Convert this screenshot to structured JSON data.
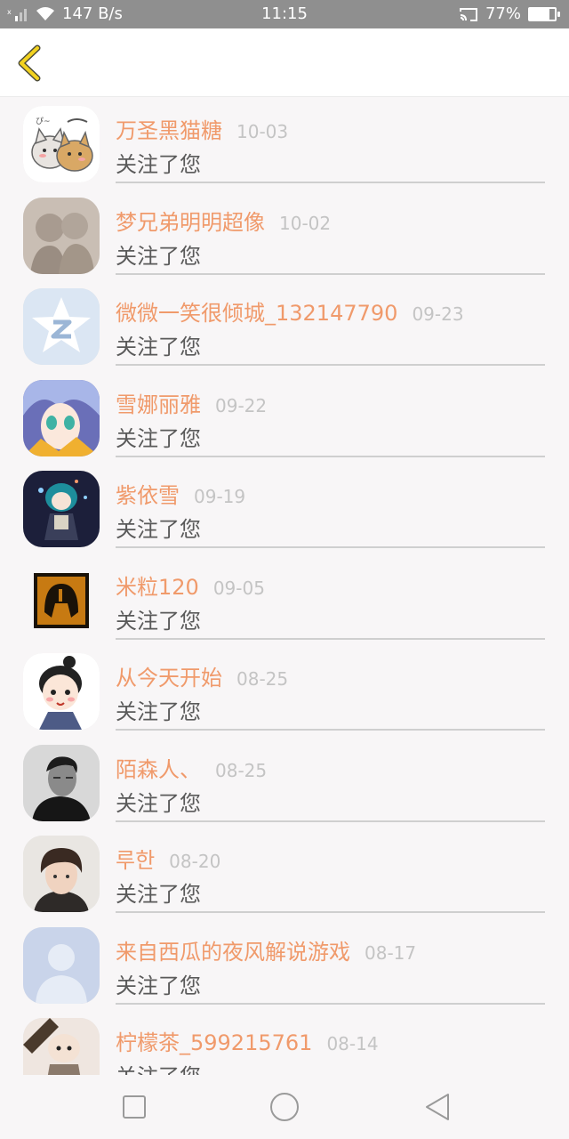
{
  "status_bar": {
    "network_speed": "147 B/s",
    "time": "11:15",
    "battery": "77%",
    "battery_level": 0.77
  },
  "header": {
    "back_icon": "chevron-left-icon"
  },
  "notifications": [
    {
      "name": "万圣黑猫糖",
      "date": "10-03",
      "action": "关注了您",
      "avatar": "cats-avatar"
    },
    {
      "name": "梦兄弟明明超像",
      "date": "10-02",
      "action": "关注了您",
      "avatar": "sketch-avatar"
    },
    {
      "name": "微微一笑很倾城_132147790",
      "date": "09-23",
      "action": "关注了您",
      "avatar": "qq-zone-avatar"
    },
    {
      "name": "雪娜丽雅",
      "date": "09-22",
      "action": "关注了您",
      "avatar": "anime-girl-avatar"
    },
    {
      "name": "紫依雪",
      "date": "09-19",
      "action": "关注了您",
      "avatar": "chibi-avatar"
    },
    {
      "name": "米粒120",
      "date": "09-05",
      "action": "关注了您",
      "avatar": "helmet-avatar"
    },
    {
      "name": "从今天开始",
      "date": "08-25",
      "action": "关注了您",
      "avatar": "cartoon-boy-avatar"
    },
    {
      "name": "陌森人、",
      "date": "08-25",
      "action": "关注了您",
      "avatar": "man-photo-avatar"
    },
    {
      "name": "루한",
      "date": "08-20",
      "action": "关注了您",
      "avatar": "young-man-avatar"
    },
    {
      "name": "来自西瓜的夜风解说游戏",
      "date": "08-17",
      "action": "关注了您",
      "avatar": "default-avatar"
    },
    {
      "name": "柠檬茶_599215761",
      "date": "08-14",
      "action": "关注了您",
      "avatar": "cartoon-avatar"
    }
  ],
  "nav_bar": {
    "recents": "square-icon",
    "home": "circle-icon",
    "back": "triangle-back-icon"
  },
  "colors": {
    "username": "#f09a6b",
    "date": "#c4c4c4",
    "back_chevron": "#f2d21f"
  }
}
